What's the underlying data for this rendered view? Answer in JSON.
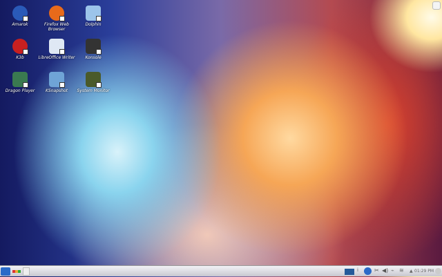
{
  "desktop": {
    "icons": [
      {
        "label": "Amarok",
        "icon": "amarok-icon",
        "color": "#2a5ab8"
      },
      {
        "label": "Firefox Web Browser",
        "icon": "firefox-icon",
        "color": "#e86a1a"
      },
      {
        "label": "Dolphin",
        "icon": "dolphin-icon",
        "color": "#9cc4ea"
      },
      {
        "label": "K3b",
        "icon": "k3b-icon",
        "color": "#c82020"
      },
      {
        "label": "LibreOffice Writer",
        "icon": "libreoffice-writer-icon",
        "color": "#dfe8f4"
      },
      {
        "label": "Konsole",
        "icon": "konsole-icon",
        "color": "#333333"
      },
      {
        "label": "Dragon Player",
        "icon": "dragon-player-icon",
        "color": "#3a7a50"
      },
      {
        "label": "KSnapshot",
        "icon": "ksnapshot-icon",
        "color": "#6fa4d6"
      },
      {
        "label": "System Monitor",
        "icon": "system-monitor-icon",
        "color": "#4a5a2a"
      }
    ]
  },
  "panel": {
    "clock": "01:29 PM",
    "launcher": "kde-kickoff-icon",
    "tray": [
      "pager-icon",
      "info-icon",
      "network-globe-icon",
      "klipper-icon",
      "volume-icon",
      "device-notifier-icon",
      "wifi-icon",
      "tray-expand-icon"
    ]
  }
}
